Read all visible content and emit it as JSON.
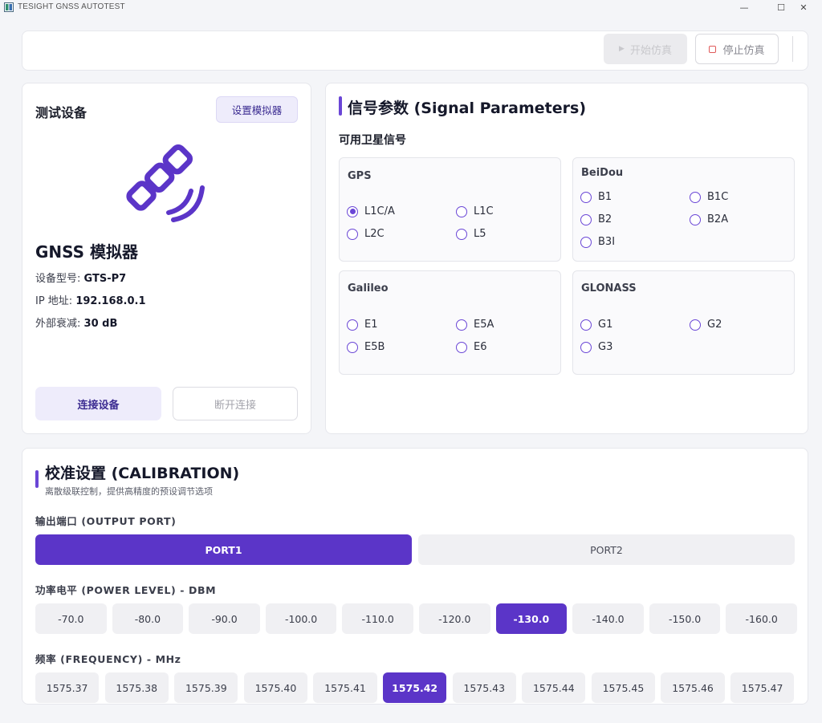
{
  "window": {
    "title": "TESIGHT GNSS AUTOTEST",
    "minimize": "—",
    "maximize": "☐",
    "close": "✕"
  },
  "toolbar": {
    "start_label": "开始仿真",
    "stop_label": "停止仿真"
  },
  "device": {
    "panel_title": "测试设备",
    "set_simulator_label": "设置模拟器",
    "icon": "satellite-icon",
    "name": "GNSS 模拟器",
    "model_key": "设备型号:",
    "model_value": "GTS-P7",
    "ip_key": "IP 地址:",
    "ip_value": "192.168.0.1",
    "atten_key": "外部衰减:",
    "atten_value": "30 dB",
    "connect_label": "连接设备",
    "disconnect_label": "断开连接"
  },
  "signal": {
    "title": "信号参数 (Signal Parameters)",
    "available_label": "可用卫星信号",
    "systems": [
      {
        "name": "GPS",
        "options": [
          "L1C/A",
          "L1C",
          "L2C",
          "L5"
        ],
        "selected": "L1C/A"
      },
      {
        "name": "BeiDou",
        "options": [
          "B1",
          "B1C",
          "B2",
          "B2A",
          "B3I"
        ],
        "selected": ""
      },
      {
        "name": "Galileo",
        "options": [
          "E1",
          "E5A",
          "E5B",
          "E6"
        ],
        "selected": ""
      },
      {
        "name": "GLONASS",
        "options": [
          "G1",
          "G2",
          "G3"
        ],
        "selected": ""
      }
    ]
  },
  "calibration": {
    "title": "校准设置 (CALIBRATION)",
    "description": "离散级联控制，提供高精度的预设调节选项",
    "port_label": "输出端口 (OUTPUT PORT)",
    "ports": [
      "PORT1",
      "PORT2"
    ],
    "port_selected": "PORT1",
    "power_label": "功率电平 (POWER LEVEL) - DBM",
    "power_levels": [
      "-70.0",
      "-80.0",
      "-90.0",
      "-100.0",
      "-110.0",
      "-120.0",
      "-130.0",
      "-140.0",
      "-150.0",
      "-160.0"
    ],
    "power_selected": "-130.0",
    "freq_label": "频率 (FREQUENCY) - MHz",
    "frequencies": [
      "1575.37",
      "1575.38",
      "1575.39",
      "1575.40",
      "1575.41",
      "1575.42",
      "1575.43",
      "1575.44",
      "1575.45",
      "1575.46",
      "1575.47"
    ],
    "freq_selected": "1575.42"
  },
  "colors": {
    "accent": "#5b35c8",
    "accent_light": "#eeecfb",
    "stop_red": "#e05a5a"
  }
}
